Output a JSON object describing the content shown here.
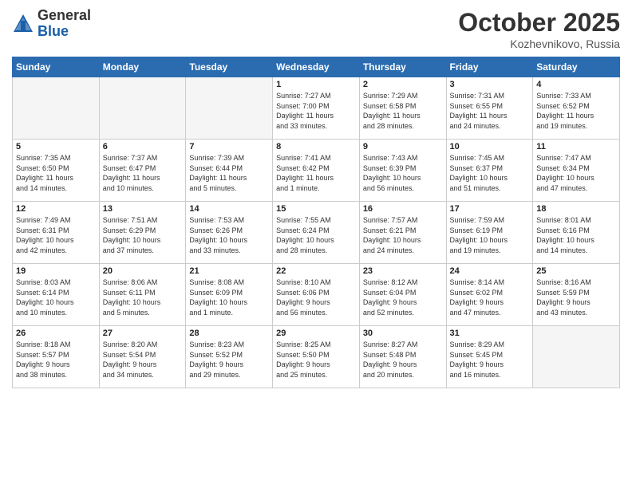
{
  "logo": {
    "general": "General",
    "blue": "Blue"
  },
  "title": "October 2025",
  "location": "Kozhevnikovo, Russia",
  "headers": [
    "Sunday",
    "Monday",
    "Tuesday",
    "Wednesday",
    "Thursday",
    "Friday",
    "Saturday"
  ],
  "weeks": [
    [
      {
        "day": "",
        "empty": true
      },
      {
        "day": "",
        "empty": true
      },
      {
        "day": "",
        "empty": true
      },
      {
        "day": "1",
        "info": "Sunrise: 7:27 AM\nSunset: 7:00 PM\nDaylight: 11 hours\nand 33 minutes."
      },
      {
        "day": "2",
        "info": "Sunrise: 7:29 AM\nSunset: 6:58 PM\nDaylight: 11 hours\nand 28 minutes."
      },
      {
        "day": "3",
        "info": "Sunrise: 7:31 AM\nSunset: 6:55 PM\nDaylight: 11 hours\nand 24 minutes."
      },
      {
        "day": "4",
        "info": "Sunrise: 7:33 AM\nSunset: 6:52 PM\nDaylight: 11 hours\nand 19 minutes."
      }
    ],
    [
      {
        "day": "5",
        "info": "Sunrise: 7:35 AM\nSunset: 6:50 PM\nDaylight: 11 hours\nand 14 minutes."
      },
      {
        "day": "6",
        "info": "Sunrise: 7:37 AM\nSunset: 6:47 PM\nDaylight: 11 hours\nand 10 minutes."
      },
      {
        "day": "7",
        "info": "Sunrise: 7:39 AM\nSunset: 6:44 PM\nDaylight: 11 hours\nand 5 minutes."
      },
      {
        "day": "8",
        "info": "Sunrise: 7:41 AM\nSunset: 6:42 PM\nDaylight: 11 hours\nand 1 minute."
      },
      {
        "day": "9",
        "info": "Sunrise: 7:43 AM\nSunset: 6:39 PM\nDaylight: 10 hours\nand 56 minutes."
      },
      {
        "day": "10",
        "info": "Sunrise: 7:45 AM\nSunset: 6:37 PM\nDaylight: 10 hours\nand 51 minutes."
      },
      {
        "day": "11",
        "info": "Sunrise: 7:47 AM\nSunset: 6:34 PM\nDaylight: 10 hours\nand 47 minutes."
      }
    ],
    [
      {
        "day": "12",
        "info": "Sunrise: 7:49 AM\nSunset: 6:31 PM\nDaylight: 10 hours\nand 42 minutes."
      },
      {
        "day": "13",
        "info": "Sunrise: 7:51 AM\nSunset: 6:29 PM\nDaylight: 10 hours\nand 37 minutes."
      },
      {
        "day": "14",
        "info": "Sunrise: 7:53 AM\nSunset: 6:26 PM\nDaylight: 10 hours\nand 33 minutes."
      },
      {
        "day": "15",
        "info": "Sunrise: 7:55 AM\nSunset: 6:24 PM\nDaylight: 10 hours\nand 28 minutes."
      },
      {
        "day": "16",
        "info": "Sunrise: 7:57 AM\nSunset: 6:21 PM\nDaylight: 10 hours\nand 24 minutes."
      },
      {
        "day": "17",
        "info": "Sunrise: 7:59 AM\nSunset: 6:19 PM\nDaylight: 10 hours\nand 19 minutes."
      },
      {
        "day": "18",
        "info": "Sunrise: 8:01 AM\nSunset: 6:16 PM\nDaylight: 10 hours\nand 14 minutes."
      }
    ],
    [
      {
        "day": "19",
        "info": "Sunrise: 8:03 AM\nSunset: 6:14 PM\nDaylight: 10 hours\nand 10 minutes."
      },
      {
        "day": "20",
        "info": "Sunrise: 8:06 AM\nSunset: 6:11 PM\nDaylight: 10 hours\nand 5 minutes."
      },
      {
        "day": "21",
        "info": "Sunrise: 8:08 AM\nSunset: 6:09 PM\nDaylight: 10 hours\nand 1 minute."
      },
      {
        "day": "22",
        "info": "Sunrise: 8:10 AM\nSunset: 6:06 PM\nDaylight: 9 hours\nand 56 minutes."
      },
      {
        "day": "23",
        "info": "Sunrise: 8:12 AM\nSunset: 6:04 PM\nDaylight: 9 hours\nand 52 minutes."
      },
      {
        "day": "24",
        "info": "Sunrise: 8:14 AM\nSunset: 6:02 PM\nDaylight: 9 hours\nand 47 minutes."
      },
      {
        "day": "25",
        "info": "Sunrise: 8:16 AM\nSunset: 5:59 PM\nDaylight: 9 hours\nand 43 minutes."
      }
    ],
    [
      {
        "day": "26",
        "info": "Sunrise: 8:18 AM\nSunset: 5:57 PM\nDaylight: 9 hours\nand 38 minutes."
      },
      {
        "day": "27",
        "info": "Sunrise: 8:20 AM\nSunset: 5:54 PM\nDaylight: 9 hours\nand 34 minutes."
      },
      {
        "day": "28",
        "info": "Sunrise: 8:23 AM\nSunset: 5:52 PM\nDaylight: 9 hours\nand 29 minutes."
      },
      {
        "day": "29",
        "info": "Sunrise: 8:25 AM\nSunset: 5:50 PM\nDaylight: 9 hours\nand 25 minutes."
      },
      {
        "day": "30",
        "info": "Sunrise: 8:27 AM\nSunset: 5:48 PM\nDaylight: 9 hours\nand 20 minutes."
      },
      {
        "day": "31",
        "info": "Sunrise: 8:29 AM\nSunset: 5:45 PM\nDaylight: 9 hours\nand 16 minutes."
      },
      {
        "day": "",
        "empty": true
      }
    ]
  ]
}
